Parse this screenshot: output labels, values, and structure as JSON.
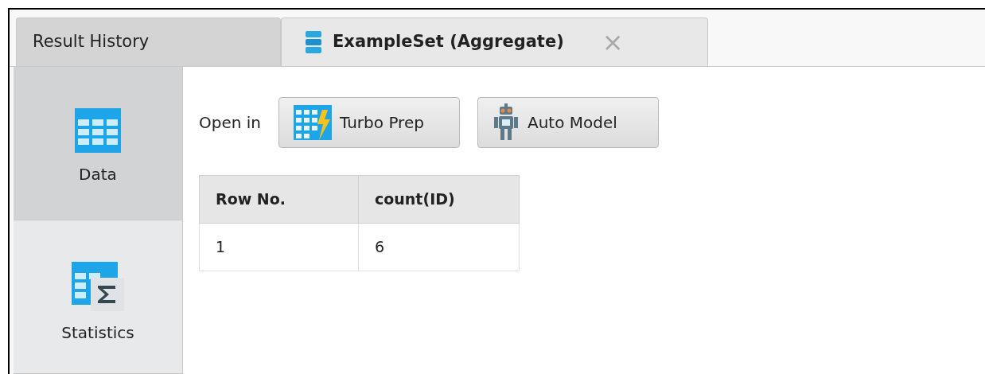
{
  "tabs": [
    {
      "label": "Result History",
      "selected": false,
      "kind": "plain"
    },
    {
      "label": "ExampleSet (Aggregate)",
      "selected": true,
      "kind": "closable",
      "close": "×"
    }
  ],
  "sidebar": {
    "items": [
      {
        "label": "Data",
        "selected": true,
        "kind": "data"
      },
      {
        "label": "Statistics",
        "selected": false,
        "kind": "statistics"
      }
    ]
  },
  "toolbar": {
    "label": "Open in",
    "buttons": [
      {
        "label": "Turbo Prep",
        "kind": "turbo"
      },
      {
        "label": "Auto Model",
        "kind": "robot"
      }
    ]
  },
  "table": {
    "columns": [
      "Row No.",
      "count(ID)"
    ],
    "rows": [
      [
        "1",
        "6"
      ]
    ]
  }
}
